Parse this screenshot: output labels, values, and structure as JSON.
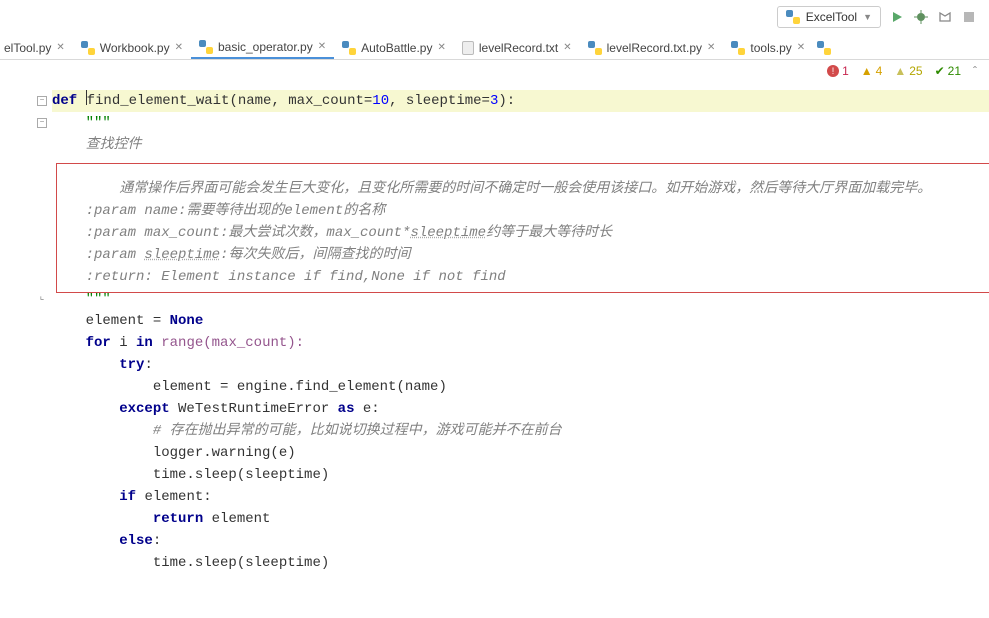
{
  "run_config": {
    "label": "ExcelTool"
  },
  "tabs": [
    {
      "label": "elTool.py",
      "icon": "py",
      "cut": true
    },
    {
      "label": "Workbook.py",
      "icon": "py"
    },
    {
      "label": "basic_operator.py",
      "icon": "py",
      "active": true
    },
    {
      "label": "AutoBattle.py",
      "icon": "py"
    },
    {
      "label": "levelRecord.txt",
      "icon": "txt"
    },
    {
      "label": "levelRecord.txt.py",
      "icon": "py"
    },
    {
      "label": "tools.py",
      "icon": "py"
    }
  ],
  "inspect": {
    "errors": 1,
    "warnings": 4,
    "weak_warnings": 25,
    "typos": 21
  },
  "code": {
    "def_kw": "def ",
    "fn_name": "find_element_wait",
    "paren_open": "(",
    "p_name": "name",
    "comma1": ", ",
    "p_max": "max_count",
    "eq1": "=",
    "v_max": "10",
    "comma2": ", ",
    "p_sleep": "sleeptime",
    "eq2": "=",
    "v_sleep": "3",
    "paren_close": "):",
    "doc_open": "    \"\"\"",
    "doc_l1": "    查找控件",
    "doc_blank": "",
    "doc_l2": "        通常操作后界面可能会发生巨大变化，且变化所需要的时间不确定时一般会使用该接口。如开始游戏，然后等待大厅界面加载完毕。",
    "doc_l3a": "    :param name:需要等待出现的element的名称",
    "doc_l4a": "    :param max_count:最大尝试次数，max_count*",
    "doc_l4b": "sleeptime",
    "doc_l4c": "约等于最大等待时长",
    "doc_l5a": "    :param ",
    "doc_l5b": "sleeptime",
    "doc_l5c": ":每次失败后，间隔查找的时间",
    "doc_l6": "    :return: Element instance if find,None if not find",
    "doc_close": "    \"\"\"",
    "body_l1a": "    element = ",
    "body_l1b": "None",
    "body_l2a": "    ",
    "body_l2kw": "for ",
    "body_l2var": "i ",
    "body_l2in": "in ",
    "body_l2call": "range(max_count):",
    "body_l3a": "        ",
    "body_l3kw": "try",
    "body_l3c": ":",
    "body_l4": "            element = engine.find_element(name)",
    "body_l5a": "        ",
    "body_l5kw": "except ",
    "body_l5cls": "WeTestRuntimeError ",
    "body_l5as": "as ",
    "body_l5e": "e:",
    "body_l6": "            # 存在抛出异常的可能，比如说切换过程中，游戏可能并不在前台",
    "body_l7": "            logger.warning(e)",
    "body_l8": "            time.sleep(sleeptime)",
    "body_l9a": "        ",
    "body_l9kw": "if ",
    "body_l9c": "element:",
    "body_l10a": "            ",
    "body_l10kw": "return ",
    "body_l10c": "element",
    "body_l11a": "        ",
    "body_l11kw": "else",
    "body_l11c": ":",
    "body_l12": "            time.sleep(sleeptime)"
  }
}
